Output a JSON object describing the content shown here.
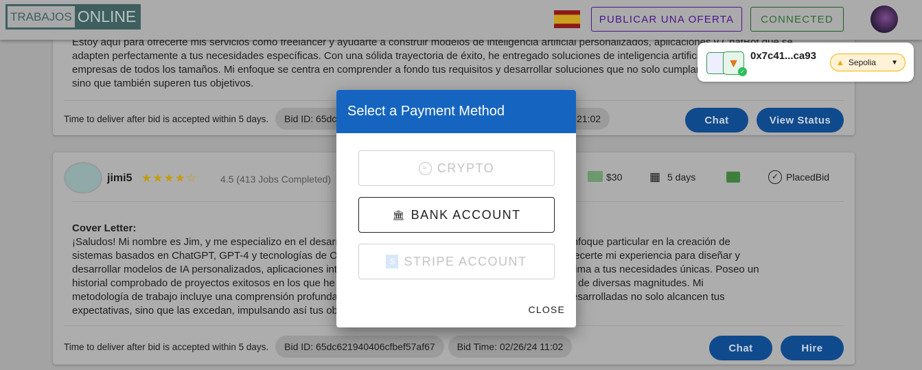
{
  "header": {
    "logo_left": "TRABAJOS",
    "logo_right": "ONLINE",
    "flag": "spain-flag",
    "publish_label": "PUBLICAR UNA OFERTA",
    "connected_label": "CONNECTED"
  },
  "wallet": {
    "address": "0x7c41...ca93",
    "network": "Sepolia"
  },
  "card1": {
    "lines": [
      "Estoy aquí para ofrecerte mis servicios como freelancer y ayudarte a construir modelos de inteligencia artificial personalizados, aplicaciones y ChatBot que se",
      "adapten perfectamente a tus necesidades específicas. Con una sólida trayectoria de éxito, he entregado soluciones de inteligencia artificial a",
      "empresas de todos los tamaños. Mi enfoque se centra en comprender a fondo tus requisitos y desarrollar soluciones que no solo cumplan,",
      "sino que también superen tus objetivos."
    ],
    "delivery": "Time to deliver after bid is accepted within 5 days.",
    "bid_id": "Bid ID: 65dc",
    "bid_time": "21:02",
    "chat": "Chat",
    "view_status": "View Status"
  },
  "card2": {
    "username": "jimi5",
    "rating": 4.5,
    "rating_text": "4.5 (413 Jobs Completed)",
    "price": "$30",
    "duration": "5 days",
    "status": "PlacedBid",
    "cover_title": "Cover Letter:",
    "lines": [
      "¡Saludos! Mi nombre es Jim, y me especializo en el desarrollo de soluciones de inteligencia artificial, con un enfoque particular en la creación de",
      "sistemas basados en ChatGPT, GPT-4 y tecnologías de OpenAI. Estoy entusiasmado con la posibilidad de ofrecerte mi experiencia para diseñar y",
      "desarrollar modelos de IA personalizados, aplicaciones inteligentes y ChatBots que se adapten de manera óptima a tus necesidades únicas. Poseo un",
      "historial comprobado de proyectos exitosos en los que he entregado soluciones innovadoras a organizaciones de diversas magnitudes. Mi",
      "metodología de trabajo incluye una comprensión profunda de tus requisitos, asegurando que las soluciones desarrolladas no solo alcancen tus",
      "expectativas, sino que las excedan, impulsando así tus objetivos."
    ],
    "delivery": "Time to deliver after bid is accepted within 5 days.",
    "bid_id": "Bid ID: 65dc621940406cfbef57af67",
    "bid_time": "Bid Time: 02/26/24 11:02",
    "chat": "Chat",
    "hire": "Hire"
  },
  "modal": {
    "title": "Select a Payment Method",
    "options": [
      {
        "label": "CRYPTO",
        "icon": "crypto-icon",
        "enabled": false
      },
      {
        "label": "BANK ACCOUNT",
        "icon": "bank-icon",
        "enabled": true
      },
      {
        "label": "STRIPE ACCOUNT",
        "icon": "stripe-icon",
        "enabled": false
      }
    ],
    "close": "CLOSE"
  },
  "colors": {
    "modal_header": "#1565c0",
    "button": "#0f4a8c",
    "publish": "#4a148c",
    "connected": "#1b5e20"
  }
}
